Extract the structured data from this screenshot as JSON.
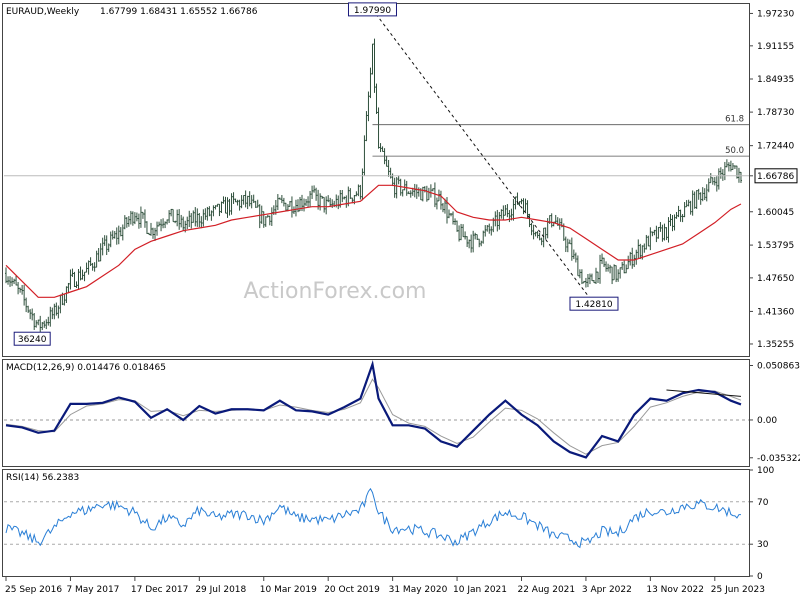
{
  "header": {
    "symbol": "EURAUD,Weekly",
    "ohlc": "1.67799 1.68431 1.65552 1.66786"
  },
  "watermark": "ActionForex.com",
  "colors": {
    "candle": "#2e4f3b",
    "ma": "#d21f26",
    "macd": "#0a1a7a",
    "signal": "#9a9a9a",
    "rsi": "#2a7fd6"
  },
  "chart_data": [
    {
      "type": "line",
      "title": "EURAUD,Weekly",
      "ylim": [
        1.33,
        1.99
      ],
      "y_ticks": [
        "1.97230",
        "1.91155",
        "1.84935",
        "1.78730",
        "1.72440",
        "1.66786",
        "1.60045",
        "1.53795",
        "1.47650",
        "1.41360",
        "1.35255"
      ],
      "y_tick_values": [
        1.9723,
        1.91155,
        1.84935,
        1.7873,
        1.7244,
        1.66786,
        1.60045,
        1.53795,
        1.4765,
        1.4136,
        1.35255
      ],
      "current_price": 1.66786,
      "x_ticks": [
        "25 Sep 2016",
        "7 May 2017",
        "17 Dec 2017",
        "29 Jul 2018",
        "10 Mar 2019",
        "20 Oct 2019",
        "31 May 2020",
        "10 Jan 2021",
        "22 Aug 2021",
        "3 Apr 2022",
        "13 Nov 2022",
        "25 Jun 2023"
      ],
      "series": [
        {
          "role": "close",
          "x": [
            "2016-09-25",
            "2016-11-20",
            "2017-01-15",
            "2017-03-12",
            "2017-05-07",
            "2017-07-02",
            "2017-08-27",
            "2017-10-22",
            "2017-12-17",
            "2018-02-11",
            "2018-04-08",
            "2018-06-03",
            "2018-07-29",
            "2018-09-23",
            "2018-11-18",
            "2019-01-13",
            "2019-03-10",
            "2019-05-05",
            "2019-06-30",
            "2019-08-25",
            "2019-10-20",
            "2019-12-15",
            "2020-02-09",
            "2020-03-22",
            "2020-04-12",
            "2020-05-31",
            "2020-07-26",
            "2020-09-20",
            "2020-11-15",
            "2021-01-10",
            "2021-03-07",
            "2021-05-02",
            "2021-06-27",
            "2021-08-22",
            "2021-10-17",
            "2021-12-12",
            "2022-02-06",
            "2022-04-03",
            "2022-05-29",
            "2022-07-24",
            "2022-09-18",
            "2022-11-13",
            "2023-01-08",
            "2023-03-05",
            "2023-04-30",
            "2023-06-25",
            "2023-08-20",
            "2023-09-24"
          ],
          "values": [
            1.485,
            1.44,
            1.385,
            1.41,
            1.47,
            1.49,
            1.53,
            1.56,
            1.6,
            1.565,
            1.595,
            1.575,
            1.59,
            1.6,
            1.615,
            1.62,
            1.585,
            1.615,
            1.615,
            1.63,
            1.61,
            1.625,
            1.64,
            1.9,
            1.72,
            1.65,
            1.64,
            1.635,
            1.625,
            1.56,
            1.545,
            1.565,
            1.6,
            1.625,
            1.55,
            1.59,
            1.53,
            1.46,
            1.5,
            1.48,
            1.52,
            1.55,
            1.565,
            1.6,
            1.63,
            1.66,
            1.69,
            1.668
          ]
        },
        {
          "name": "MA",
          "x": [
            "2016-09-25",
            "2016-11-20",
            "2017-01-15",
            "2017-03-12",
            "2017-05-07",
            "2017-07-02",
            "2017-08-27",
            "2017-10-22",
            "2017-12-17",
            "2018-02-11",
            "2018-04-08",
            "2018-06-03",
            "2018-07-29",
            "2018-09-23",
            "2018-11-18",
            "2019-01-13",
            "2019-03-10",
            "2019-05-05",
            "2019-06-30",
            "2019-08-25",
            "2019-10-20",
            "2019-12-15",
            "2020-02-09",
            "2020-03-22",
            "2020-04-12",
            "2020-05-31",
            "2020-07-26",
            "2020-09-20",
            "2020-11-15",
            "2021-01-10",
            "2021-03-07",
            "2021-05-02",
            "2021-06-27",
            "2021-08-22",
            "2021-10-17",
            "2021-12-12",
            "2022-02-06",
            "2022-04-03",
            "2022-05-29",
            "2022-07-24",
            "2022-09-18",
            "2022-11-13",
            "2023-01-08",
            "2023-03-05",
            "2023-04-30",
            "2023-06-25",
            "2023-08-20",
            "2023-09-24"
          ],
          "values": [
            1.5,
            1.47,
            1.44,
            1.44,
            1.45,
            1.46,
            1.48,
            1.5,
            1.53,
            1.545,
            1.555,
            1.565,
            1.57,
            1.575,
            1.585,
            1.59,
            1.595,
            1.6,
            1.605,
            1.61,
            1.61,
            1.615,
            1.62,
            1.64,
            1.65,
            1.65,
            1.645,
            1.64,
            1.63,
            1.6,
            1.59,
            1.585,
            1.585,
            1.59,
            1.585,
            1.58,
            1.57,
            1.55,
            1.53,
            1.51,
            1.51,
            1.52,
            1.53,
            1.54,
            1.56,
            1.58,
            1.605,
            1.615
          ]
        }
      ],
      "annotations": [
        {
          "text": "1.97990",
          "x": "2020-03-22",
          "y": 1.9799
        },
        {
          "text": "1.42810",
          "x": "2022-05-01",
          "y": 1.4281
        },
        {
          "text": "36240",
          "x": "2016-12-25",
          "y": 1.3624
        },
        {
          "text": "61.8",
          "y": 1.7637
        },
        {
          "text": "50.0",
          "y": 1.7048
        }
      ]
    },
    {
      "type": "line",
      "title": "MACD(12,26,9) 0.014476 0.018465",
      "ylim": [
        -0.043,
        0.056
      ],
      "y_ticks": [
        "0.050863",
        "0.00",
        "-0.035322"
      ],
      "y_tick_values": [
        0.050863,
        0.0,
        -0.035322
      ],
      "series": [
        {
          "role": "macd",
          "x": [
            "2016-09-25",
            "2016-11-20",
            "2017-01-15",
            "2017-03-12",
            "2017-05-07",
            "2017-07-02",
            "2017-08-27",
            "2017-10-22",
            "2017-12-17",
            "2018-02-11",
            "2018-04-08",
            "2018-06-03",
            "2018-07-29",
            "2018-09-23",
            "2018-11-18",
            "2019-01-13",
            "2019-03-10",
            "2019-05-05",
            "2019-06-30",
            "2019-08-25",
            "2019-10-20",
            "2019-12-15",
            "2020-02-09",
            "2020-03-22",
            "2020-04-12",
            "2020-05-31",
            "2020-07-26",
            "2020-09-20",
            "2020-11-15",
            "2021-01-10",
            "2021-03-07",
            "2021-05-02",
            "2021-06-27",
            "2021-08-22",
            "2021-10-17",
            "2021-12-12",
            "2022-02-06",
            "2022-04-03",
            "2022-05-29",
            "2022-07-24",
            "2022-09-18",
            "2022-11-13",
            "2023-01-08",
            "2023-03-05",
            "2023-04-30",
            "2023-06-25",
            "2023-08-20",
            "2023-09-24"
          ],
          "values": [
            -0.005,
            -0.007,
            -0.012,
            -0.01,
            0.015,
            0.015,
            0.016,
            0.021,
            0.017,
            0.002,
            0.01,
            0.0,
            0.013,
            0.006,
            0.01,
            0.01,
            0.009,
            0.018,
            0.009,
            0.008,
            0.005,
            0.012,
            0.02,
            0.052,
            0.02,
            -0.005,
            -0.005,
            -0.008,
            -0.02,
            -0.025,
            -0.01,
            0.005,
            0.018,
            0.005,
            -0.005,
            -0.02,
            -0.03,
            -0.035,
            -0.015,
            -0.02,
            0.005,
            0.02,
            0.018,
            0.025,
            0.028,
            0.026,
            0.018,
            0.014476
          ]
        },
        {
          "role": "signal",
          "x": [
            "2016-09-25",
            "2016-11-20",
            "2017-01-15",
            "2017-03-12",
            "2017-05-07",
            "2017-07-02",
            "2017-08-27",
            "2017-10-22",
            "2017-12-17",
            "2018-02-11",
            "2018-04-08",
            "2018-06-03",
            "2018-07-29",
            "2018-09-23",
            "2018-11-18",
            "2019-01-13",
            "2019-03-10",
            "2019-05-05",
            "2019-06-30",
            "2019-08-25",
            "2019-10-20",
            "2019-12-15",
            "2020-02-09",
            "2020-03-22",
            "2020-04-12",
            "2020-05-31",
            "2020-07-26",
            "2020-09-20",
            "2020-11-15",
            "2021-01-10",
            "2021-03-07",
            "2021-05-02",
            "2021-06-27",
            "2021-08-22",
            "2021-10-17",
            "2021-12-12",
            "2022-02-06",
            "2022-04-03",
            "2022-05-29",
            "2022-07-24",
            "2022-09-18",
            "2022-11-13",
            "2023-01-08",
            "2023-03-05",
            "2023-04-30",
            "2023-06-25",
            "2023-08-20",
            "2023-09-24"
          ],
          "values": [
            -0.004,
            -0.006,
            -0.01,
            -0.011,
            0.005,
            0.013,
            0.015,
            0.019,
            0.018,
            0.008,
            0.009,
            0.004,
            0.009,
            0.008,
            0.009,
            0.01,
            0.009,
            0.014,
            0.012,
            0.009,
            0.007,
            0.01,
            0.016,
            0.038,
            0.03,
            0.005,
            -0.003,
            -0.006,
            -0.015,
            -0.022,
            -0.016,
            -0.002,
            0.011,
            0.009,
            0.001,
            -0.012,
            -0.024,
            -0.032,
            -0.024,
            -0.021,
            -0.006,
            0.012,
            0.016,
            0.022,
            0.026,
            0.027,
            0.022,
            0.018465
          ]
        }
      ]
    },
    {
      "type": "line",
      "title": "RSI(14) 56.2383",
      "ylim": [
        0,
        100
      ],
      "y_ticks": [
        "100",
        "70",
        "30",
        "0"
      ],
      "y_tick_values": [
        100,
        70,
        30,
        0
      ],
      "series": [
        {
          "role": "rsi",
          "x": [
            "2016-09-25",
            "2016-11-20",
            "2017-01-15",
            "2017-03-12",
            "2017-05-07",
            "2017-07-02",
            "2017-08-27",
            "2017-10-22",
            "2017-12-17",
            "2018-02-11",
            "2018-04-08",
            "2018-06-03",
            "2018-07-29",
            "2018-09-23",
            "2018-11-18",
            "2019-01-13",
            "2019-03-10",
            "2019-05-05",
            "2019-06-30",
            "2019-08-25",
            "2019-10-20",
            "2019-12-15",
            "2020-02-09",
            "2020-03-22",
            "2020-04-12",
            "2020-05-31",
            "2020-07-26",
            "2020-09-20",
            "2020-11-15",
            "2021-01-10",
            "2021-03-07",
            "2021-05-02",
            "2021-06-27",
            "2021-08-22",
            "2021-10-17",
            "2021-12-12",
            "2022-02-06",
            "2022-04-03",
            "2022-05-29",
            "2022-07-24",
            "2022-09-18",
            "2022-11-13",
            "2023-01-08",
            "2023-03-05",
            "2023-04-30",
            "2023-06-25",
            "2023-08-20",
            "2023-09-24"
          ],
          "values": [
            45,
            40,
            32,
            45,
            60,
            62,
            68,
            66,
            60,
            45,
            55,
            48,
            62,
            55,
            58,
            58,
            52,
            66,
            55,
            54,
            52,
            58,
            62,
            82,
            60,
            45,
            45,
            42,
            38,
            32,
            42,
            52,
            60,
            56,
            48,
            38,
            35,
            30,
            42,
            40,
            55,
            62,
            60,
            66,
            68,
            65,
            60,
            56.2383
          ]
        }
      ]
    }
  ]
}
